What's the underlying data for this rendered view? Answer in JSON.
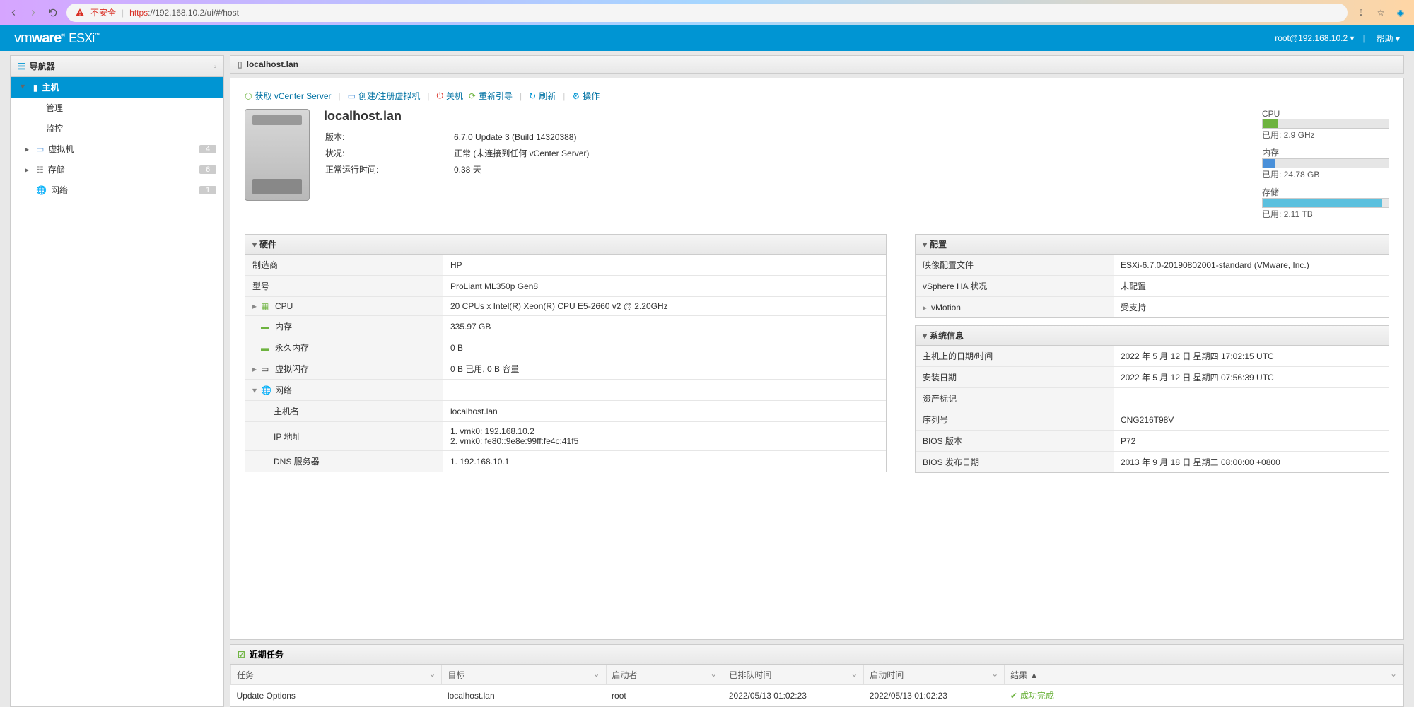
{
  "browser": {
    "warn_text": "不安全",
    "url_scheme": "https",
    "url_rest": "://192.168.10.2/ui/#/host"
  },
  "header": {
    "logo_vm": "vm",
    "logo_ware": "ware",
    "logo_esxi": "ESXi",
    "user": "root@192.168.10.2",
    "help": "帮助"
  },
  "sidebar": {
    "title": "导航器",
    "items": {
      "host": "主机",
      "manage": "管理",
      "monitor": "监控",
      "vms": "虚拟机",
      "storage": "存储",
      "network": "网络"
    },
    "badges": {
      "vms": "4",
      "storage": "6",
      "network": "1"
    }
  },
  "breadcrumb": "localhost.lan",
  "actions": {
    "vcenter": "获取 vCenter Server",
    "create_vm": "创建/注册虚拟机",
    "shutdown": "关机",
    "reboot": "重新引导",
    "refresh": "刷新",
    "actions": "操作"
  },
  "host": {
    "name": "localhost.lan",
    "version_label": "版本:",
    "version": "6.7.0 Update 3 (Build 14320388)",
    "state_label": "状况:",
    "state": "正常 (未连接到任何 vCenter Server)",
    "uptime_label": "正常运行时间:",
    "uptime": "0.38 天"
  },
  "stats": {
    "cpu_label": "CPU",
    "cpu_used": "已用: 2.9 GHz",
    "mem_label": "内存",
    "mem_used": "已用: 24.78 GB",
    "storage_label": "存储",
    "storage_used": "已用: 2.11 TB"
  },
  "hardware": {
    "title": "硬件",
    "rows": {
      "vendor_k": "制造商",
      "vendor_v": "HP",
      "model_k": "型号",
      "model_v": "ProLiant ML350p Gen8",
      "cpu_k": "CPU",
      "cpu_v": "20 CPUs x Intel(R) Xeon(R) CPU E5-2660 v2 @ 2.20GHz",
      "mem_k": "内存",
      "mem_v": "335.97 GB",
      "pmem_k": "永久内存",
      "pmem_v": "0 B",
      "vflash_k": "虚拟闪存",
      "vflash_v": "0 B 已用, 0 B 容量",
      "net_k": "网络",
      "hostname_k": "主机名",
      "hostname_v": "localhost.lan",
      "ip_k": "IP 地址",
      "ip_v1": "1. vmk0: 192.168.10.2",
      "ip_v2": "2. vmk0: fe80::9e8e:99ff:fe4c:41f5",
      "dns_k": "DNS 服务器",
      "dns_v": "1. 192.168.10.1"
    }
  },
  "config": {
    "title": "配置",
    "rows": {
      "image_k": "映像配置文件",
      "image_v": "ESXi-6.7.0-20190802001-standard (VMware, Inc.)",
      "ha_k": "vSphere HA 状况",
      "ha_v": "未配置",
      "vmotion_k": "vMotion",
      "vmotion_v": "受支持"
    }
  },
  "sysinfo": {
    "title": "系统信息",
    "rows": {
      "date_k": "主机上的日期/时间",
      "date_v": "2022 年 5 月 12 日 星期四 17:02:15 UTC",
      "install_k": "安装日期",
      "install_v": "2022 年 5 月 12 日 星期四 07:56:39 UTC",
      "asset_k": "资产标记",
      "asset_v": "",
      "serial_k": "序列号",
      "serial_v": "CNG216T98V",
      "bios_k": "BIOS 版本",
      "bios_v": "P72",
      "biosdate_k": "BIOS 发布日期",
      "biosdate_v": "2013 年 9 月 18 日 星期三 08:00:00 +0800"
    }
  },
  "tasks": {
    "title": "近期任务",
    "cols": {
      "task": "任务",
      "target": "目标",
      "initiator": "启动者",
      "queued": "已排队时间",
      "started": "启动时间",
      "result": "结果 ▲"
    },
    "row": {
      "task": "Update Options",
      "target": "localhost.lan",
      "initiator": "root",
      "queued": "2022/05/13 01:02:23",
      "started": "2022/05/13 01:02:23",
      "result": "成功完成"
    }
  }
}
